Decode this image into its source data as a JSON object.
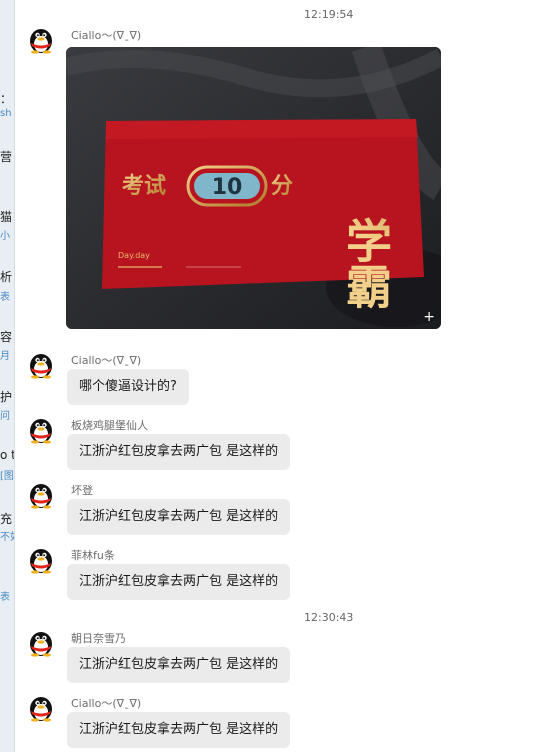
{
  "sidebar_fragments": [
    {
      "text": "：",
      "sub": false
    },
    {
      "text": "sh",
      "sub": true
    },
    {
      "text": "营",
      "sub": false
    },
    {
      "text": "猫",
      "sub": false
    },
    {
      "text": "小",
      "sub": true
    },
    {
      "text": "析",
      "sub": false
    },
    {
      "text": "表",
      "sub": true
    },
    {
      "text": "容",
      "sub": false
    },
    {
      "text": "月",
      "sub": true
    },
    {
      "text": "护",
      "sub": false
    },
    {
      "text": "问",
      "sub": true
    },
    {
      "text": "o t",
      "sub": false
    },
    {
      "text": "[图",
      "sub": true
    },
    {
      "text": "充",
      "sub": false
    },
    {
      "text": "不如",
      "sub": true
    },
    {
      "text": "表",
      "sub": true
    }
  ],
  "timestamps": [
    "12:19:54",
    "12:30:43"
  ],
  "photo": {
    "envelope_text": "考试",
    "badge_number": "10",
    "envelope_suffix": "分",
    "calligraphy": "学霸",
    "small_text": "Day.day"
  },
  "messages": [
    {
      "sender": "Ciallo～(∇ˍ∇)",
      "text": ""
    },
    {
      "sender": "Ciallo～(∇ˍ∇)",
      "text": "哪个傻逼设计的?"
    },
    {
      "sender": "板烧鸡腿堡仙人",
      "text": "江浙沪红包皮拿去两广包  是这样的"
    },
    {
      "sender": "坏登",
      "text": "江浙沪红包皮拿去两广包  是这样的"
    },
    {
      "sender": "菲林fu条",
      "text": "江浙沪红包皮拿去两广包  是这样的"
    },
    {
      "sender": "朝日奈雪乃",
      "text": "江浙沪红包皮拿去两广包  是这样的"
    },
    {
      "sender": "Ciallo～(∇ˍ∇)",
      "text": "江浙沪红包皮拿去两广包  是这样的"
    }
  ],
  "colors": {
    "bubble": "#ebebeb",
    "envelope_red": "#b8141f",
    "gold": "#e8b86a"
  },
  "icons": {
    "avatar": "qq-penguin-icon",
    "expand": "expand-plus-icon"
  }
}
